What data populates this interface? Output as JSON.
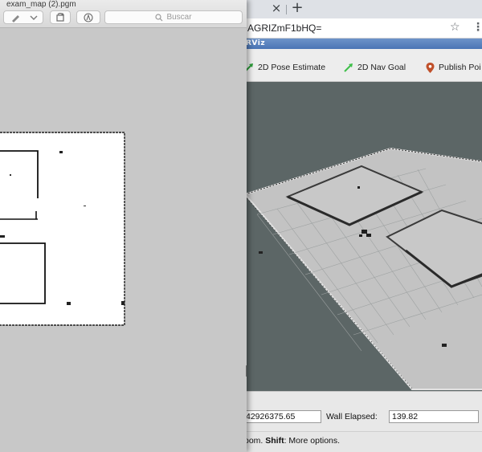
{
  "preview": {
    "title": "exam_map (2).pgm",
    "search_placeholder": "Buscar"
  },
  "browser": {
    "url": "AGRIZmF1bHQ=",
    "close_glyph": "×",
    "new_tab_glyph": "+",
    "star_icon": "star-icon",
    "more_icon": "more-icon"
  },
  "rviz": {
    "title": "RViz",
    "toolbar": {
      "pose_estimate": "2D Pose Estimate",
      "nav_goal": "2D Nav Goal",
      "publish_point": "Publish Poi"
    },
    "time": {
      "ros_time_value": "42926375.65",
      "wall_elapsed_label": "Wall Elapsed:",
      "wall_elapsed_value": "139.82"
    },
    "status": {
      "prefix": "oom. ",
      "bold": "Shift",
      "suffix": ": More options."
    }
  },
  "colors": {
    "viewport_bg": "#5c6666",
    "map_floor": "#c4c4c4",
    "map_border": "#d4d4d4",
    "pose_arrow": "#2d9c3a",
    "nav_arrow": "#3fbf4a",
    "publish_pin": "#c0502a"
  }
}
